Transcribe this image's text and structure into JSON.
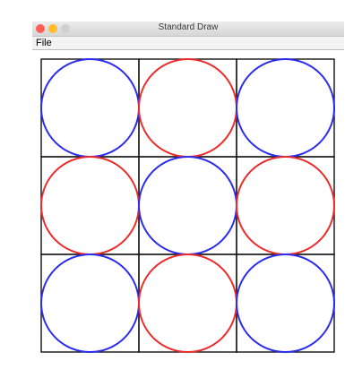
{
  "window": {
    "title": "Standard Draw",
    "traffic_colors": {
      "close": "#ff5f57",
      "minimize": "#ffbd2e",
      "maximize": "#d0d0d0"
    }
  },
  "menu": {
    "file_label": "File"
  },
  "drawing": {
    "rows": 3,
    "cols": 3,
    "circle_colors": [
      [
        "blue",
        "red",
        "blue"
      ],
      [
        "red",
        "blue",
        "red"
      ],
      [
        "blue",
        "red",
        "blue"
      ]
    ],
    "palette": {
      "blue": "#2b2bf0",
      "red": "#ee2b2b",
      "grid": "#111111"
    }
  }
}
